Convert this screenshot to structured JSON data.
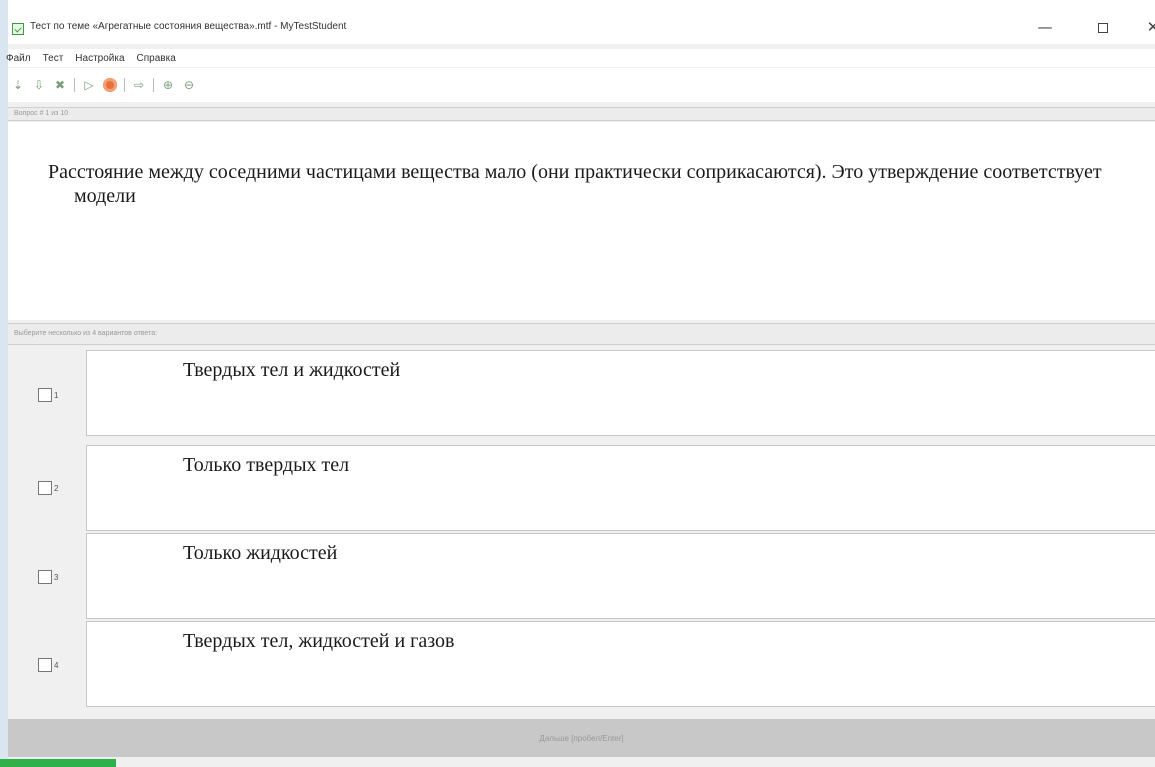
{
  "window": {
    "title": "Тест по теме «Агрегатные состояния вещества».mtf - MyTestStudent",
    "minimize_glyph": "—",
    "close_glyph": "✕"
  },
  "menu": [
    "Файл",
    "Тест",
    "Настройка",
    "Справка"
  ],
  "toolbar": {
    "icons": [
      "first-icon",
      "down-icon",
      "cancel-icon",
      "play-icon",
      "record-icon",
      "export-icon",
      "zoom-in-icon",
      "zoom-out-icon"
    ]
  },
  "status": {
    "question_counter": "Вопрос # 1 из 10"
  },
  "question": {
    "text": "Расстояние между соседними частицами вещества мало (они практически соприкасаются). Это утверждение соответствует модели"
  },
  "instruction": "Выберите несколько из 4 вариантов ответа:",
  "answers": [
    {
      "num": "1",
      "text": "Твердых тел и жидкостей"
    },
    {
      "num": "2",
      "text": "Только твердых тел"
    },
    {
      "num": "3",
      "text": "Только жидкостей"
    },
    {
      "num": "4",
      "text": "Твердых тел, жидкостей и газов"
    }
  ],
  "footer": {
    "next_label": "Дальше [пробел/Enter]"
  },
  "colors": {
    "accent_green": "#2fb14a",
    "record_orange": "#e8703a"
  }
}
